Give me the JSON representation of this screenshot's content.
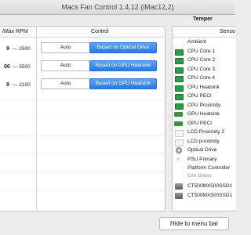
{
  "window": {
    "title": "Macs Fan Control 1.4.12 (iMac12,2)"
  },
  "tabs": {
    "temperature_partial": "Temper"
  },
  "fans_table": {
    "header_rpm": "/Max RPM",
    "header_control": "Control",
    "rows": [
      {
        "current_partial": "9",
        "max_rpm": "— 2500",
        "auto_label": "Auto",
        "sensor_label": "Based on Optical Drive"
      },
      {
        "current_partial": "00",
        "max_rpm": "— 5500",
        "auto_label": "Auto",
        "sensor_label": "Based on GPU Heatsink"
      },
      {
        "current_partial": "9",
        "max_rpm": "— 2100",
        "auto_label": "Auto",
        "sensor_label": "Based on GPU Heatsink"
      }
    ]
  },
  "sensors": {
    "header_partial": "Senso",
    "items": [
      {
        "name": "Ambient",
        "icon": "none"
      },
      {
        "name": "CPU Core 1",
        "icon": "cpu-chip-icon"
      },
      {
        "name": "CPU Core 2",
        "icon": "cpu-chip-icon"
      },
      {
        "name": "CPU Core 3",
        "icon": "cpu-chip-icon"
      },
      {
        "name": "CPU Core 4",
        "icon": "cpu-chip-icon"
      },
      {
        "name": "CPU Heatsink",
        "icon": "cpu-chip-icon"
      },
      {
        "name": "CPU PECI",
        "icon": "cpu-chip-icon"
      },
      {
        "name": "CPU Proximity",
        "icon": "cpu-chip-icon"
      },
      {
        "name": "GPU Heatsink",
        "icon": "gpu-card-icon"
      },
      {
        "name": "GPU PECI",
        "icon": "gpu-card-icon"
      },
      {
        "name": "LCD Proximity 2",
        "icon": "lcd-icon"
      },
      {
        "name": "LCD proximity",
        "icon": "lcd-icon"
      },
      {
        "name": "Optical Drive",
        "icon": "optical-disc-icon"
      },
      {
        "name": "PSU Primary",
        "icon": "power-plug-icon"
      },
      {
        "name": "Platform Controller",
        "icon": "none"
      }
    ],
    "disk_drives_label": "Disk Drives:",
    "disks": [
      {
        "name": "CT500MX500SSD1"
      },
      {
        "name": "CT500MX500SSD1"
      }
    ]
  },
  "footer": {
    "hide_button": "Hide to menu bar"
  }
}
